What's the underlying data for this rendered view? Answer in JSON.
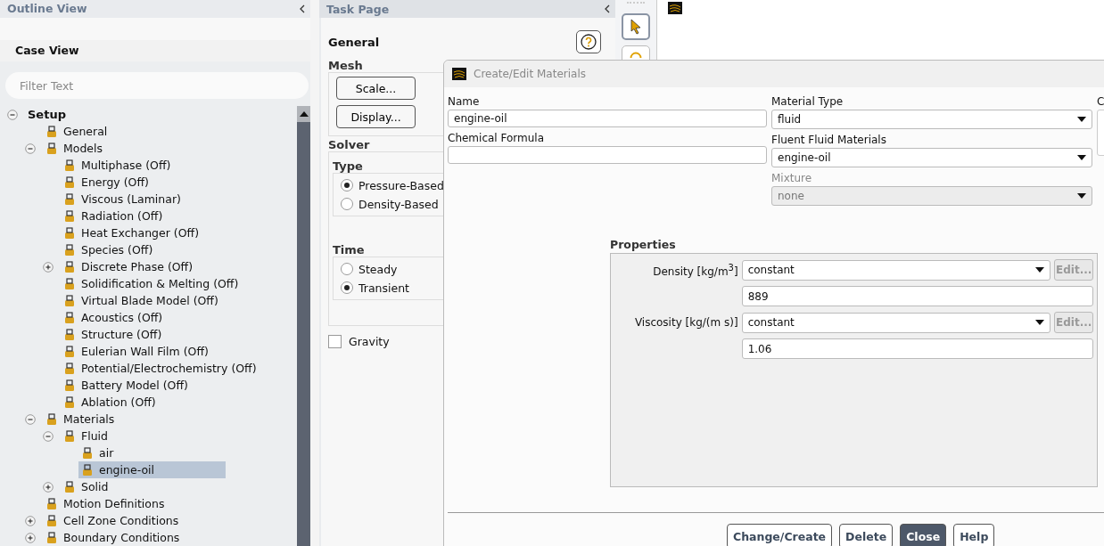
{
  "outline": {
    "title": "Outline View",
    "case_view": "Case View",
    "filter": {
      "placeholder": "Filter Text"
    },
    "tree": [
      {
        "label": "Setup",
        "expanded": true,
        "selected": false,
        "children": [
          {
            "label": "General",
            "selected": false
          },
          {
            "label": "Models",
            "expanded": true,
            "selected": false,
            "children": [
              {
                "label": "Multiphase (Off)",
                "selected": false
              },
              {
                "label": "Energy (Off)",
                "selected": false
              },
              {
                "label": "Viscous (Laminar)",
                "selected": false
              },
              {
                "label": "Radiation (Off)",
                "selected": false
              },
              {
                "label": "Heat Exchanger (Off)",
                "selected": false
              },
              {
                "label": "Species (Off)",
                "selected": false
              },
              {
                "label": "Discrete Phase (Off)",
                "expanded": false,
                "selected": false
              },
              {
                "label": "Solidification & Melting (Off)",
                "selected": false
              },
              {
                "label": "Virtual Blade Model (Off)",
                "selected": false
              },
              {
                "label": "Acoustics (Off)",
                "selected": false
              },
              {
                "label": "Structure (Off)",
                "selected": false
              },
              {
                "label": "Eulerian Wall Film (Off)",
                "selected": false
              },
              {
                "label": "Potential/Electrochemistry (Off)",
                "selected": false
              },
              {
                "label": "Battery Model (Off)",
                "selected": false
              },
              {
                "label": "Ablation (Off)",
                "selected": false
              }
            ]
          },
          {
            "label": "Materials",
            "expanded": true,
            "selected": false,
            "children": [
              {
                "label": "Fluid",
                "expanded": true,
                "selected": false,
                "children": [
                  {
                    "label": "air",
                    "selected": false
                  },
                  {
                    "label": "engine-oil",
                    "selected": true
                  }
                ]
              },
              {
                "label": "Solid",
                "expanded": false,
                "selected": false
              }
            ]
          },
          {
            "label": "Motion Definitions",
            "selected": false
          },
          {
            "label": "Cell Zone Conditions",
            "expanded": false,
            "selected": false
          },
          {
            "label": "Boundary Conditions",
            "expanded": false,
            "selected": false
          }
        ]
      }
    ]
  },
  "task_page": {
    "title": "Task Page",
    "heading": "General",
    "mesh": {
      "title": "Mesh",
      "buttons": [
        "Scale...",
        "Display..."
      ]
    },
    "solver": {
      "title": "Solver",
      "type": {
        "title": "Type",
        "options": [
          {
            "label": "Pressure-Based",
            "selected": true
          },
          {
            "label": "Density-Based",
            "selected": false
          }
        ]
      },
      "time": {
        "title": "Time",
        "options": [
          {
            "label": "Steady",
            "selected": false
          },
          {
            "label": "Transient",
            "selected": true
          }
        ]
      }
    },
    "gravity": {
      "label": "Gravity",
      "checked": false
    }
  },
  "dialog": {
    "title": "Create/Edit Materials",
    "name": {
      "label": "Name",
      "value": "engine-oil"
    },
    "formula": {
      "label": "Chemical Formula"
    },
    "material_type": {
      "label": "Material Type",
      "value": "fluid",
      "disabled": false
    },
    "fluent_materials": {
      "label": "Fluent Fluid Materials",
      "value": "engine-oil",
      "disabled": false
    },
    "mixture": {
      "label": "Mixture",
      "value": "none",
      "disabled": true
    },
    "column_3": {
      "label": "C"
    },
    "properties": {
      "title": "Properties",
      "rows": [
        {
          "label": "Density [kg/m$^{3}$]",
          "method": "constant",
          "edit": "Edit...",
          "edit_disabled": true,
          "value": "889"
        },
        {
          "label": "Viscosity [kg/(m s)]",
          "method": "constant",
          "edit": "Edit...",
          "edit_disabled": true,
          "value": "1.06"
        }
      ]
    },
    "buttons": [
      {
        "label": "Change/Create",
        "primary": false
      },
      {
        "label": "Delete",
        "primary": false
      },
      {
        "label": "Close",
        "primary": true
      },
      {
        "label": "Help",
        "primary": false
      }
    ]
  }
}
